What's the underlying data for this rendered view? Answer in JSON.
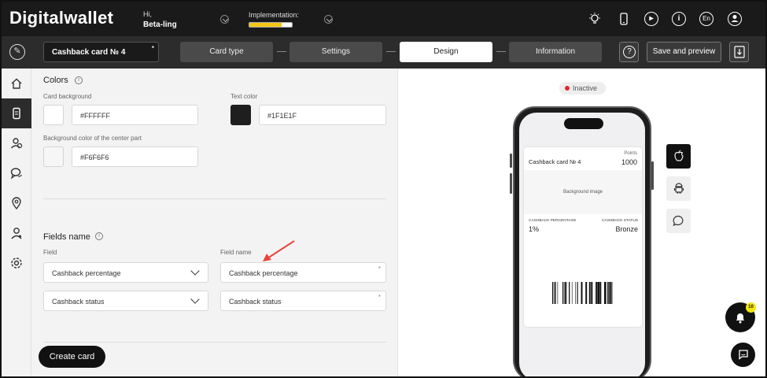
{
  "topbar": {
    "logo": "Digitalwallet",
    "greeting": "Hi,",
    "user_name": "Beta-ling",
    "implementation_label": "Implementation:",
    "implementation_progress": 0.75,
    "language": "En",
    "icons": [
      "bulb-icon",
      "phone-icon",
      "play-icon",
      "info-icon",
      "language-icon",
      "profile-icon"
    ]
  },
  "navbar": {
    "card_name": "Cashback card № 4",
    "card_name_required": "*",
    "steps": [
      {
        "label": "Card type",
        "active": false
      },
      {
        "label": "Settings",
        "active": false
      },
      {
        "label": "Design",
        "active": true
      },
      {
        "label": "Information",
        "active": false
      }
    ],
    "help_label": "?",
    "save_preview_label": "Save and preview"
  },
  "sidebar": {
    "items": [
      "home-icon",
      "card-icon",
      "users-icon",
      "chat-icon",
      "location-icon",
      "manager-icon",
      "settings-icon"
    ],
    "active_index": 1
  },
  "colors_section": {
    "title": "Colors",
    "card_background_label": "Card background",
    "card_background_value": "#FFFFFF",
    "text_color_label": "Text color",
    "text_color_value": "#1F1E1F",
    "center_bg_label": "Background color of the center part",
    "center_bg_value": "#F6F6F6"
  },
  "fields_section": {
    "title": "Fields name",
    "field_label": "Field",
    "field_name_label": "Field name",
    "rows": [
      {
        "field": "Cashback percentage",
        "name": "Cashback percentage",
        "required": "*"
      },
      {
        "field": "Cashback status",
        "name": "Cashback status",
        "required": "*"
      }
    ]
  },
  "create_card_label": "Create card",
  "preview": {
    "status": "Inactive",
    "status_color": "#e8232b",
    "pass": {
      "name": "Cashback card № 4",
      "points_label": "Points",
      "points_value": "1000",
      "background_label": "Background image",
      "field1_label": "CASHBACK PERCENTAGE",
      "field1_value": "1%",
      "field2_label": "CASHBACK STATUS",
      "field2_value": "Bronze"
    },
    "platforms": [
      "apple-icon",
      "android-icon",
      "message-icon"
    ],
    "active_platform": "apple-icon",
    "notifications_count": "10"
  }
}
